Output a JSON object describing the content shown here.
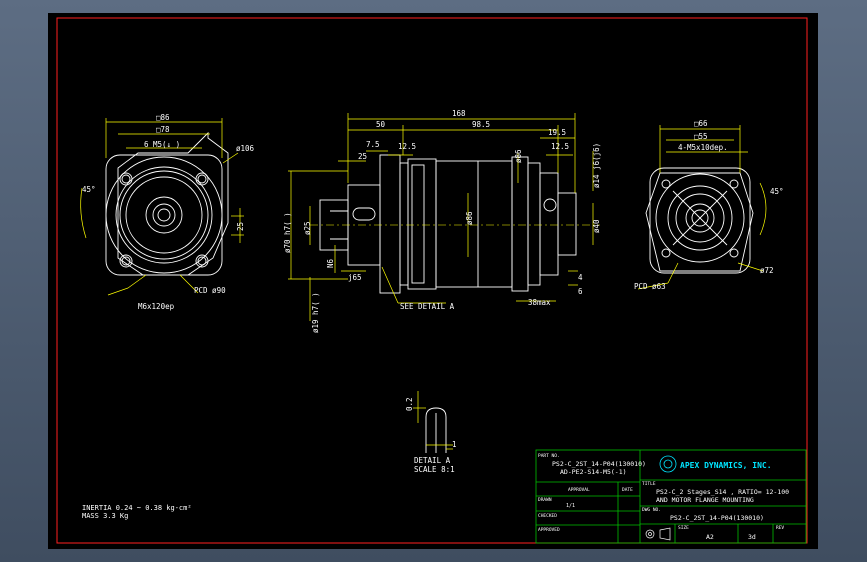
{
  "colors": {
    "background": "#000000",
    "border": "#ff2020",
    "geometry": "#ffffff",
    "dimension": "#ffff00",
    "titleblock": "#00c000",
    "text": "#ffffff",
    "logo": "#00e5ff"
  },
  "left_view": {
    "dim_sq86": "□86",
    "dim_sq78": "□78",
    "dim_tap": "6 M5(↓ )",
    "dim_o106": "ø106",
    "dim_45": "45°",
    "dim_25": "25",
    "dim_pcd": "PCD ø90",
    "dim_m6": "M6x120ep"
  },
  "center_view": {
    "dim_168": "168",
    "dim_50": "50",
    "dim_985": "98.5",
    "dim_195": "19.5",
    "dim_75": "7.5",
    "dim_25": "25",
    "dim_125a": "12.5",
    "dim_125b": "12.5",
    "dim_o86": "ø86",
    "dim_o14": "ø14 j6(j6)",
    "dim_o40": "ø40",
    "dim_o70": "ø70 h7(  )",
    "dim_o25": "ø25",
    "dim_n6": "N6",
    "dim_j65": "j65",
    "dim_o19": "ø19 h7(  )",
    "see_detail": "SEE DETAIL A",
    "dim_38max": "38max",
    "dim_4": "4",
    "dim_6": "6",
    "dim_100": "ø86"
  },
  "right_view": {
    "dim_sq66": "□66",
    "dim_sq55": "□55",
    "dim_m5": "4-M5x10dep.",
    "dim_45": "45°",
    "dim_o72": "ø72",
    "dim_pcd": "PCD ø63"
  },
  "detail": {
    "title": "DETAIL A",
    "scale": "SCALE 8:1",
    "dim_02": "0.2",
    "dim_1": "1"
  },
  "notes": {
    "inertia": "INERTIA 0.24 ~ 0.38 kg-cm²",
    "mass": "MASS 3.3 Kg"
  },
  "titleblock": {
    "part_no_label": "PART NO.",
    "part_no_1": "PS2-C_2ST_14-P04(130010)",
    "part_no_2": "AD-PE2-S14-M5(-1)",
    "approval": "APPROVAL",
    "date": "DATE",
    "title_label": "TITLE",
    "drawn": "DRAWN",
    "drawn_val": "1/1",
    "checked": "CHECKED",
    "approved": "APPROVED",
    "company": "APEX DYNAMICS, INC.",
    "title_1": "PS2-C_2 Stages_S14 , RATIO= 12-100",
    "title_2": "AND MOTOR FLANGE MOUNTING",
    "dwg_no_label": "DWG NO.",
    "dwg_no": "PS2-C_2ST_14-P04(130010)",
    "size_label": "SIZE",
    "size": "A2",
    "sheet_label": "",
    "sheet": "3d",
    "rev_label": "REV"
  }
}
